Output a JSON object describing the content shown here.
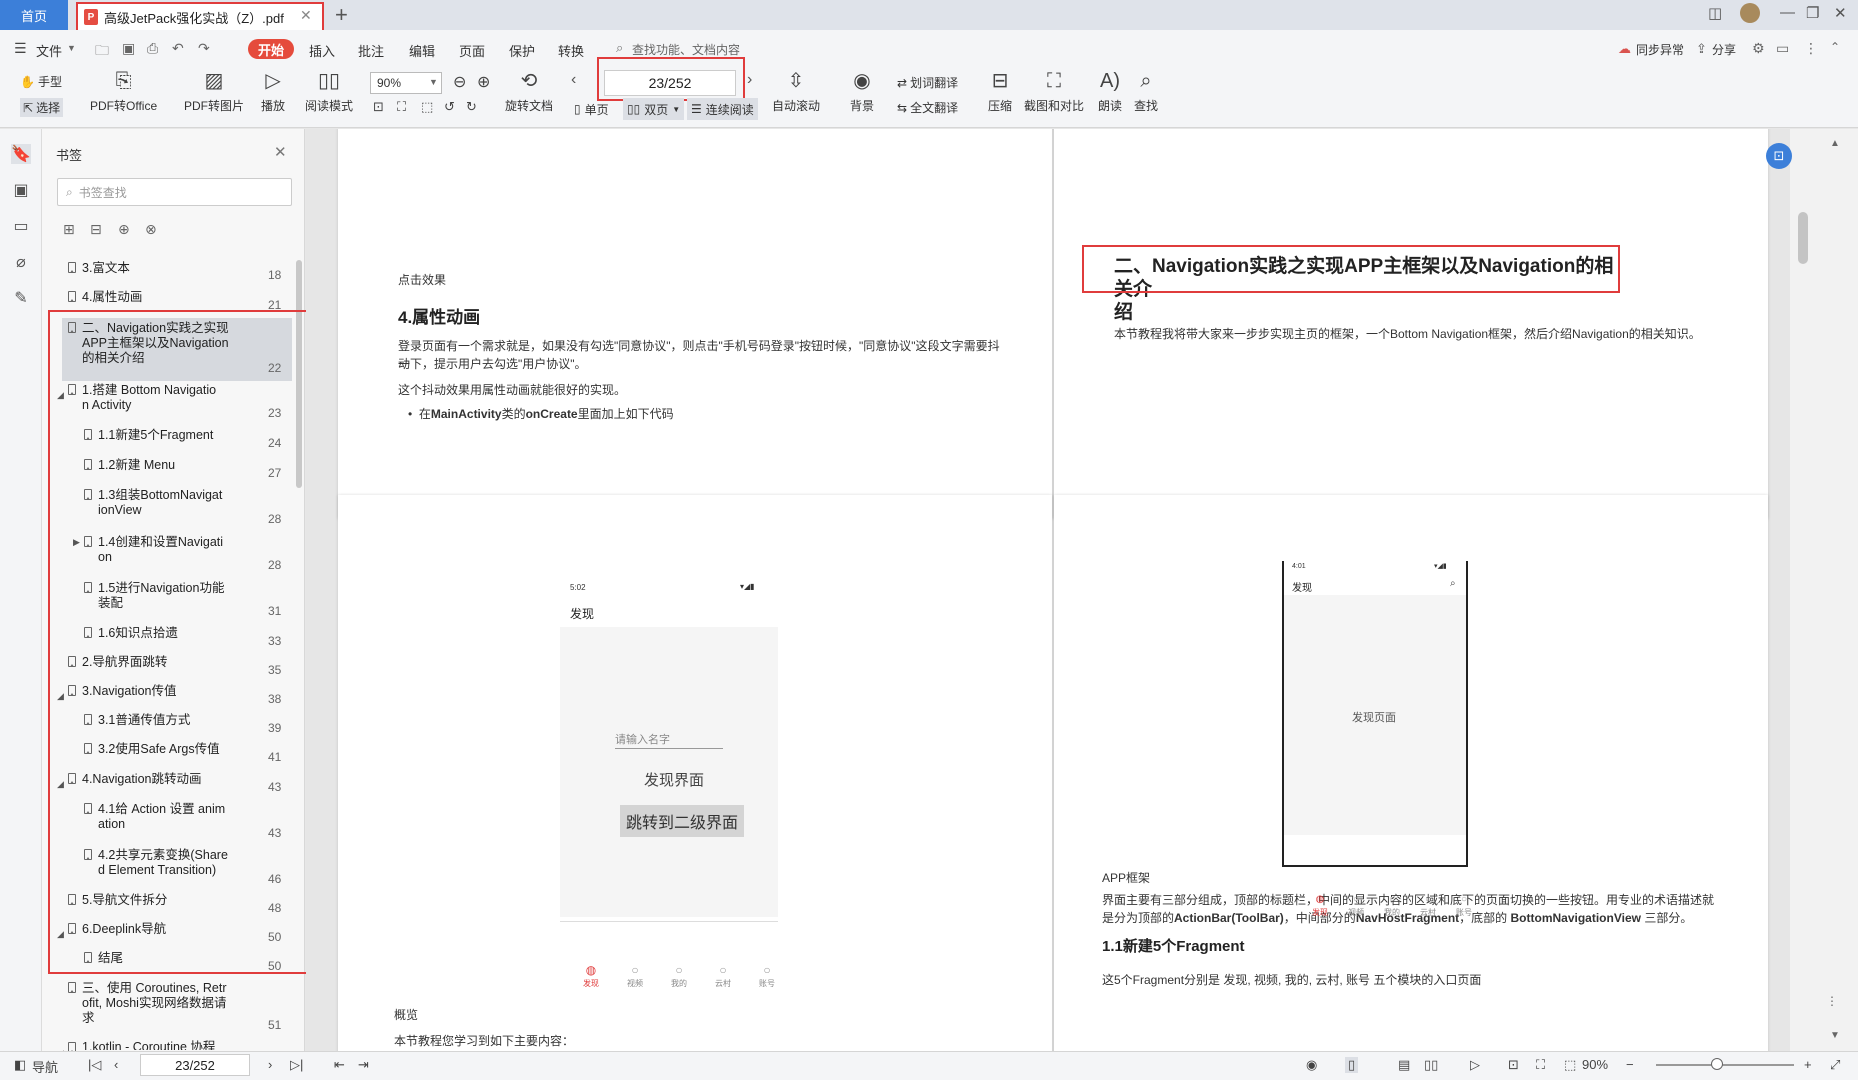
{
  "titlebar": {
    "home_tab": "首页",
    "doc_tab": "高级JetPack强化实战（Z）.pdf",
    "pdf_badge": "P",
    "new_tab": "+"
  },
  "menu": {
    "file": "文件",
    "start": "开始",
    "items": [
      "插入",
      "批注",
      "编辑",
      "页面",
      "保护",
      "转换"
    ],
    "search_placeholder": "查找功能、文档内容",
    "sync": "同步异常",
    "share": "分享"
  },
  "ribbon": {
    "hand": "手型",
    "select": "选择",
    "pdf_to_office": "PDF转Office",
    "pdf_to_image": "PDF转图片",
    "play": "播放",
    "read_mode": "阅读模式",
    "zoom": "90%",
    "rotate": "旋转文档",
    "page_input": "23/252",
    "single": "单页",
    "double": "双页",
    "continuous": "连续阅读",
    "autoscroll": "自动滚动",
    "background": "背景",
    "word_translate": "划词翻译",
    "full_translate": "全文翻译",
    "compress": "压缩",
    "screenshot": "截图和对比",
    "read_aloud": "朗读",
    "find": "查找"
  },
  "bookmarks": {
    "title": "书签",
    "search_placeholder": "书签查找",
    "items": [
      {
        "label": "3.富文本",
        "page": "18"
      },
      {
        "label": "4.属性动画",
        "page": "21"
      },
      {
        "label": "二、Navigation实践之实现\nAPP主框架以及Navigation\n的相关介绍",
        "page": "22"
      },
      {
        "label": "1.搭建 Bottom Navigatio\nn Activity",
        "page": "23"
      },
      {
        "label": "1.1新建5个Fragment",
        "page": "24"
      },
      {
        "label": "1.2新建 Menu",
        "page": "27"
      },
      {
        "label": "1.3组装BottomNavigat\nionView",
        "page": "28"
      },
      {
        "label": "1.4创建和设置Navigati\non",
        "page": "28"
      },
      {
        "label": "1.5进行Navigation功能\n装配",
        "page": "31"
      },
      {
        "label": "1.6知识点拾遗",
        "page": "33"
      },
      {
        "label": "2.导航界面跳转",
        "page": "35"
      },
      {
        "label": "3.Navigation传值",
        "page": "38"
      },
      {
        "label": "3.1普通传值方式",
        "page": "39"
      },
      {
        "label": "3.2使用Safe Args传值",
        "page": "41"
      },
      {
        "label": "4.Navigation跳转动画",
        "page": "43"
      },
      {
        "label": "4.1给 Action 设置 anim\nation",
        "page": "43"
      },
      {
        "label": "4.2共享元素变换(Share\nd Element Transition)",
        "page": "46"
      },
      {
        "label": "5.导航文件拆分",
        "page": "48"
      },
      {
        "label": "6.Deeplink导航",
        "page": "50"
      },
      {
        "label": "结尾",
        "page": "50"
      },
      {
        "label": "三、使用 Coroutines, Retr\nofit, Moshi实现网络数据请\n求",
        "page": "51"
      },
      {
        "label": "1.kotlin - Coroutine 协程",
        "page": ""
      }
    ]
  },
  "page_left_top": {
    "caption": "点击效果",
    "heading": "4.属性动画",
    "para1": "登录页面有一个需求就是，如果没有勾选\"同意协议\"，则点击\"手机号码登录\"按钮时候，\"同意协议\"这段文字需要抖动",
    "para1b": "一下，提示用户去勾选\"用户协议\"。",
    "para2": "这个抖动效果用属性动画就能很好的实现。",
    "bullet_pre": "在",
    "bullet_b1": "MainActivity",
    "bullet_mid": "类的",
    "bullet_b2": "onCreate",
    "bullet_post": "里面加上如下代码"
  },
  "page_right_top": {
    "heading_line1": "二、Navigation实践之实现APP主框架以及Navigation的相关介",
    "heading_line2": "绍",
    "para": "本节教程我将带大家来一步步实现主页的框架，一个Bottom Navigation框架，然后介绍Navigation的相关知识。"
  },
  "page_left_bottom": {
    "phone_time": "5:02",
    "phone_title": "发现",
    "input_hint": "请输入名字",
    "screen_label": "发现界面",
    "button": "跳转到二级界面",
    "tabs": [
      "发现",
      "视频",
      "我的",
      "云村",
      "账号"
    ],
    "overview": "概览",
    "overview_text": "本节教程您学习到如下主要内容："
  },
  "page_right_bottom": {
    "phone_time": "4:01",
    "phone_title": "发现",
    "screen_label": "发现页面",
    "tabs": [
      "发现",
      "视频",
      "我的",
      "云村",
      "账号"
    ],
    "caption": "APP框架",
    "para1": "界面主要有三部分组成，顶部的标题栏，中间的显示内容的区域和底下的页面切换的一些按钮。用专业的术语描述就",
    "para2_pre": "是分为顶部的",
    "para2_b1": "ActionBar(ToolBar)",
    "para2_mid1": "，中间部分的",
    "para2_b2": "NavHostFragment",
    "para2_mid2": "，底部的 ",
    "para2_b3": "BottomNavigationView",
    "para2_post": " 三部分。",
    "heading": "1.1新建5个Fragment",
    "cut_text": "这5个Fragment分别是 发现, 视频, 我的, 云村, 账号 五个模块的入口页面"
  },
  "statusbar": {
    "nav": "导航",
    "page": "23/252",
    "zoom": "90%"
  },
  "colors": {
    "accent_red": "#e03c3c",
    "home_blue": "#3c7fd9",
    "tab_red": "#e54b3c"
  }
}
